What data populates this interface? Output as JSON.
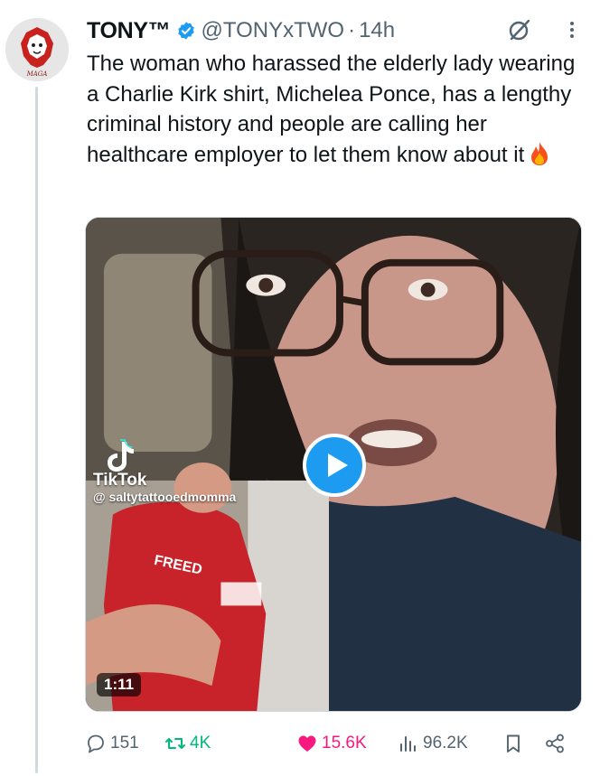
{
  "author": {
    "display_name": "TONY™",
    "handle": "@TONYxTWO",
    "separator": "·",
    "time": "14h",
    "avatar_text": "MAGA",
    "verified_color": "#1d9bf0"
  },
  "tweet": {
    "text": "The woman who harassed the elderly lady wearing a Charlie Kirk shirt, Michelea Ponce, has a lengthy criminal history and people are calling her healthcare employer to let them know about it",
    "emoji": "fire-icon"
  },
  "media": {
    "type": "video",
    "overlay_brand": "TikTok",
    "overlay_user": "@ saltytattooedmomma",
    "duration": "1:11",
    "play_color": "#1d9bf0"
  },
  "actions": {
    "replies": "151",
    "retweets": "4K",
    "likes": "15.6K",
    "views": "96.2K",
    "like_color": "#f91880",
    "retweet_color": "#00ba7c"
  }
}
